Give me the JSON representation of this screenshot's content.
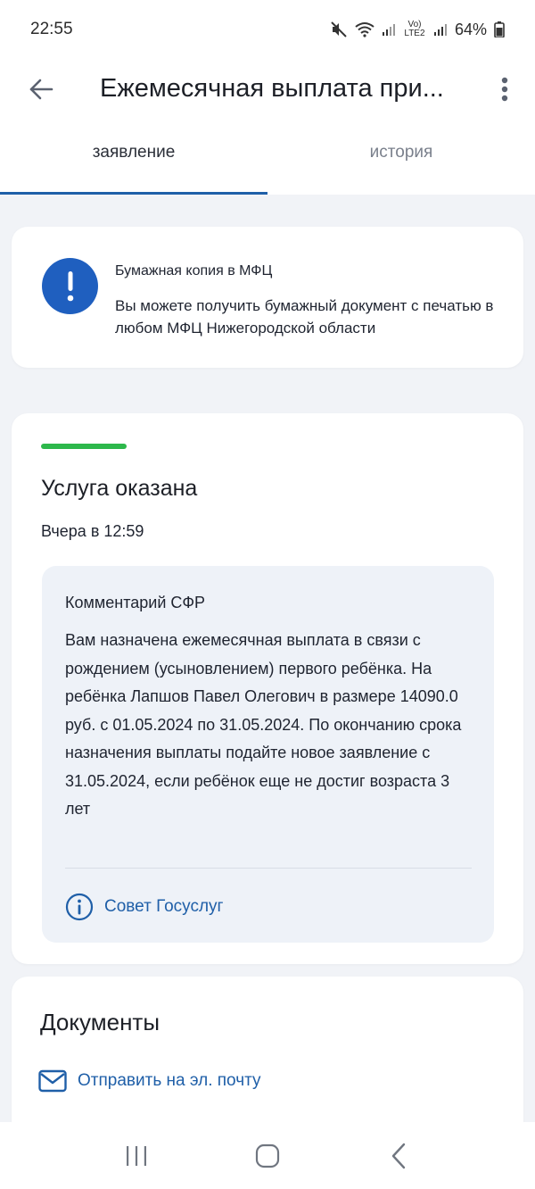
{
  "status_bar": {
    "time": "22:55",
    "battery": "64%",
    "network": "Vo) LTE2"
  },
  "app_bar": {
    "title": "Ежемесячная выплата при...",
    "back_icon": "arrow-left-icon",
    "more_icon": "more-vertical-icon"
  },
  "tabs": [
    {
      "label": "заявление",
      "active": true
    },
    {
      "label": "история",
      "active": false
    }
  ],
  "info_card": {
    "icon": "exclamation-icon",
    "title": "Бумажная копия в МФЦ",
    "text": "Вы можете получить бумажный документ с печатью в любом МФЦ Нижегородской области"
  },
  "status_card": {
    "status": "Услуга оказана",
    "time": "Вчера в 12:59",
    "comment_title": "Комментарий СФР",
    "comment_text": "Вам назначена ежемесячная выплата в связи с рождением (усыновлением) первого ребёнка. На ребёнка Лапшов Павел Олегович в размере 14090.0 руб. с 01.05.2024 по 31.05.2024. По окончанию срока назначения выплаты подайте новое заявление с 31.05.2024, если ребёнок еще не достиг возраста 3 лет",
    "advice_label": "Совет Госуслуг",
    "progress_color": "#2db84b"
  },
  "documents_card": {
    "title": "Документы",
    "email_label": "Отправить на эл. почту"
  },
  "colors": {
    "accent": "#1f5fa8",
    "info_icon_bg": "#1f5fbf",
    "background": "#f1f3f7"
  }
}
